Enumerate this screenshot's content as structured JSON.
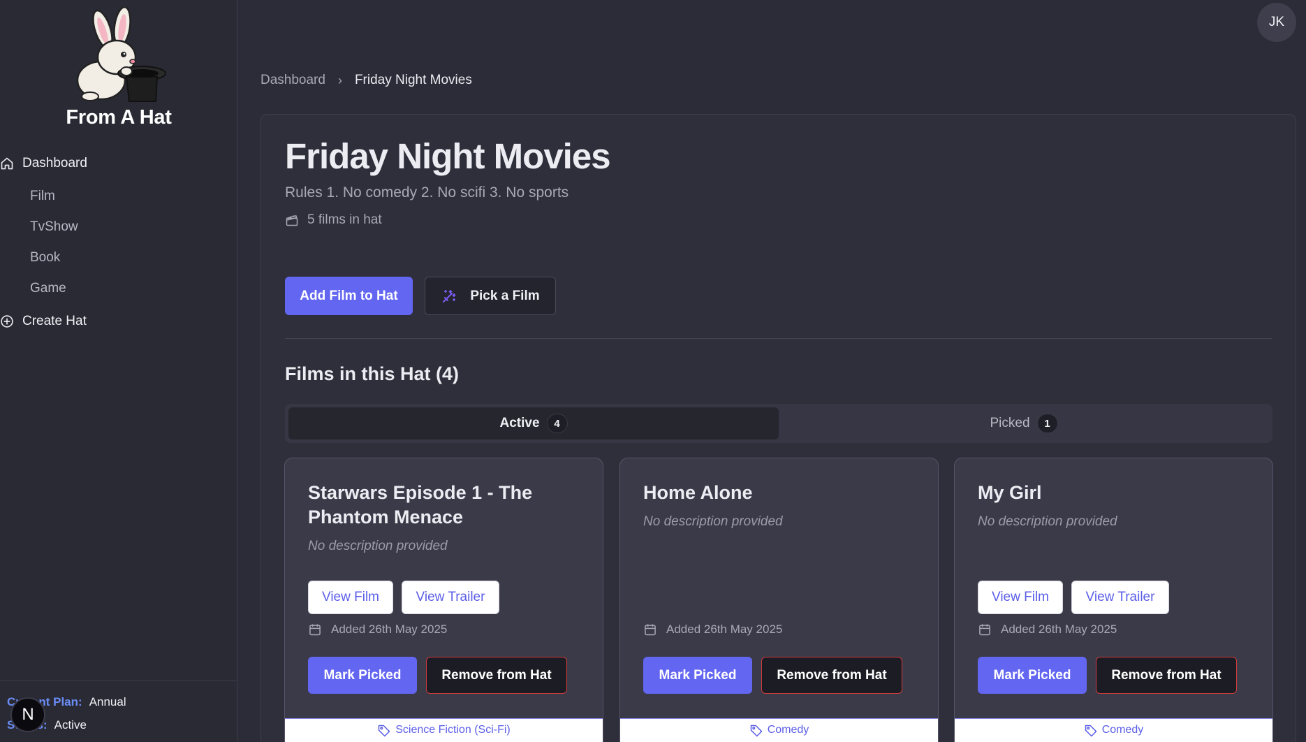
{
  "brand": {
    "name": "From A Hat"
  },
  "sidebar": {
    "items": [
      {
        "label": "Dashboard",
        "icon": "home-icon"
      },
      {
        "label": "Film"
      },
      {
        "label": "TvShow"
      },
      {
        "label": "Book"
      },
      {
        "label": "Game"
      },
      {
        "label": "Create Hat",
        "icon": "plus-circle-icon"
      }
    ],
    "plan": {
      "label": "Current Plan:",
      "value": "Annual"
    },
    "status": {
      "label": "Status:",
      "value": "Active"
    },
    "n_badge": "N"
  },
  "header": {
    "avatar_initials": "JK"
  },
  "breadcrumb": {
    "parent": "Dashboard",
    "separator": "›",
    "current": "Friday Night Movies"
  },
  "hat": {
    "title": "Friday Night Movies",
    "description": "Rules 1. No comedy 2. No scifi 3. No sports",
    "count_text": "5 films in hat"
  },
  "actions": {
    "add_label": "Add Film to Hat",
    "pick_label": "Pick a Film"
  },
  "films_section": {
    "title": "Films in this Hat (4)",
    "tabs": [
      {
        "label": "Active",
        "count": "4"
      },
      {
        "label": "Picked",
        "count": "1"
      }
    ]
  },
  "cards": [
    {
      "title": "Starwars Episode 1 - The Phantom Menace",
      "description": "No description provided",
      "view_film": "View Film",
      "view_trailer": "View Trailer",
      "added": "Added 26th May 2025",
      "mark_picked": "Mark Picked",
      "remove": "Remove from Hat",
      "tag": "Science Fiction (Sci-Fi)"
    },
    {
      "title": "Home Alone",
      "description": "No description provided",
      "added": "Added 26th May 2025",
      "mark_picked": "Mark Picked",
      "remove": "Remove from Hat",
      "tag": "Comedy"
    },
    {
      "title": "My Girl",
      "description": "No description provided",
      "view_film": "View Film",
      "view_trailer": "View Trailer",
      "added": "Added 26th May 2025",
      "mark_picked": "Mark Picked",
      "remove": "Remove from Hat",
      "tag": "Comedy"
    }
  ],
  "colors": {
    "accent": "#6366f1",
    "danger": "#d13b3b",
    "background": "#2c2c38",
    "link": "#6a8df5"
  }
}
